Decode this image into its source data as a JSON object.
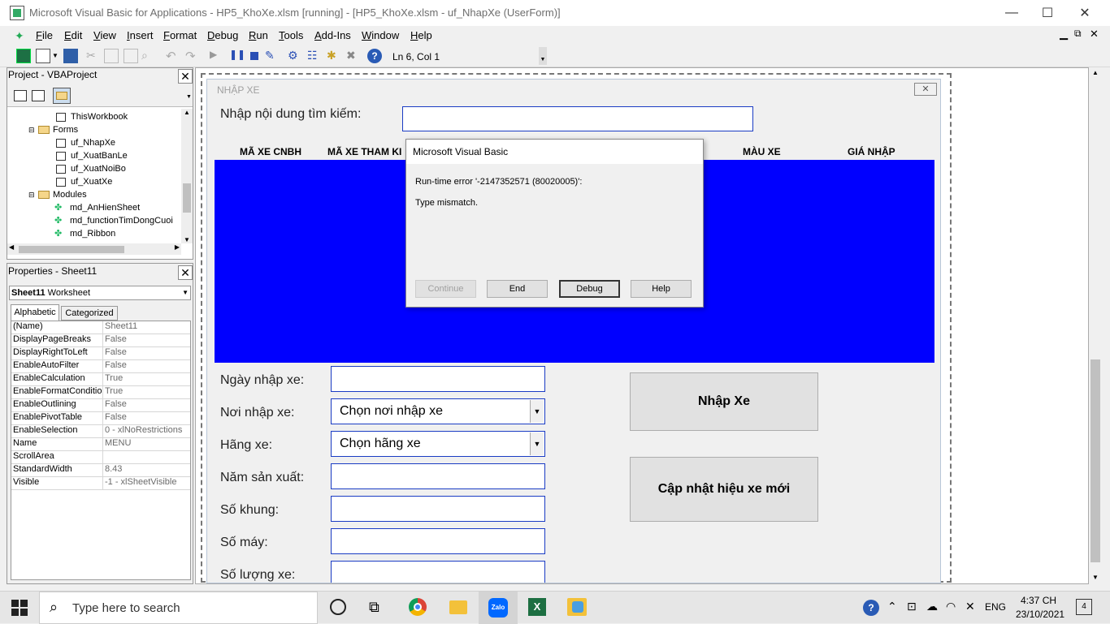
{
  "window": {
    "title": "Microsoft Visual Basic for Applications - HP5_KhoXe.xlsm [running] - [HP5_KhoXe.xlsm - uf_NhapXe (UserForm)]",
    "minimize": "—",
    "maximize": "☐",
    "close": "✕"
  },
  "menu": [
    "File",
    "Edit",
    "View",
    "Insert",
    "Format",
    "Debug",
    "Run",
    "Tools",
    "Add-Ins",
    "Window",
    "Help"
  ],
  "toolbar": {
    "position": "Ln 6, Col 1"
  },
  "project": {
    "title": "Project - VBAProject",
    "items": [
      {
        "label": "ThisWorkbook",
        "kind": "sheet"
      },
      {
        "label": "Forms",
        "kind": "folder"
      },
      {
        "label": "uf_NhapXe",
        "kind": "form"
      },
      {
        "label": "uf_XuatBanLe",
        "kind": "form"
      },
      {
        "label": "uf_XuatNoiBo",
        "kind": "form"
      },
      {
        "label": "uf_XuatXe",
        "kind": "form"
      },
      {
        "label": "Modules",
        "kind": "folder"
      },
      {
        "label": "md_AnHienSheet",
        "kind": "module"
      },
      {
        "label": "md_functionTimDongCuoi",
        "kind": "module"
      },
      {
        "label": "md_Ribbon",
        "kind": "module"
      }
    ]
  },
  "properties": {
    "title": "Properties - Sheet11",
    "object_name": "Sheet11",
    "object_type": "Worksheet",
    "tab_alpha": "Alphabetic",
    "tab_cat": "Categorized",
    "rows": [
      {
        "name": "(Name)",
        "value": "Sheet11"
      },
      {
        "name": "DisplayPageBreaks",
        "value": "False"
      },
      {
        "name": "DisplayRightToLeft",
        "value": "False"
      },
      {
        "name": "EnableAutoFilter",
        "value": "False"
      },
      {
        "name": "EnableCalculation",
        "value": "True"
      },
      {
        "name": "EnableFormatCondition",
        "value": "True"
      },
      {
        "name": "EnableOutlining",
        "value": "False"
      },
      {
        "name": "EnablePivotTable",
        "value": "False"
      },
      {
        "name": "EnableSelection",
        "value": "0 - xlNoRestrictions"
      },
      {
        "name": "Name",
        "value": "MENU"
      },
      {
        "name": "ScrollArea",
        "value": ""
      },
      {
        "name": "StandardWidth",
        "value": "8.43"
      },
      {
        "name": "Visible",
        "value": "-1 - xlSheetVisible"
      }
    ]
  },
  "form": {
    "caption": "NHẬP XE",
    "search_label": "Nhập nội dung tìm kiếm:",
    "columns": [
      "MÃ XE CNBH",
      "MÃ XE THAM KI",
      "MÀU XE",
      "GIÁ NHẬP"
    ],
    "fields": [
      {
        "label": "Ngày nhập xe:",
        "type": "text",
        "value": ""
      },
      {
        "label": "Nơi nhập xe:",
        "type": "combo",
        "value": "Chọn nơi nhập xe"
      },
      {
        "label": "Hãng xe:",
        "type": "combo",
        "value": "Chọn hãng xe"
      },
      {
        "label": "Năm sản xuất:",
        "type": "text",
        "value": ""
      },
      {
        "label": "Số khung:",
        "type": "text",
        "value": ""
      },
      {
        "label": "Số máy:",
        "type": "text",
        "value": ""
      },
      {
        "label": "Số lượng xe:",
        "type": "text",
        "value": ""
      }
    ],
    "btn_nhap": "Nhập Xe",
    "btn_capnhat": "Cập nhật hiệu xe mới",
    "list_color": "#0000ff"
  },
  "dialog": {
    "title": "Microsoft Visual Basic",
    "error": "Run-time error '-2147352571 (80020005)':",
    "message": "Type mismatch.",
    "buttons": [
      "Continue",
      "End",
      "Debug",
      "Help"
    ]
  },
  "taskbar": {
    "search_placeholder": "Type here to search",
    "lang": "ENG",
    "time": "4:37 CH",
    "date": "23/10/2021",
    "notifications": "4"
  }
}
